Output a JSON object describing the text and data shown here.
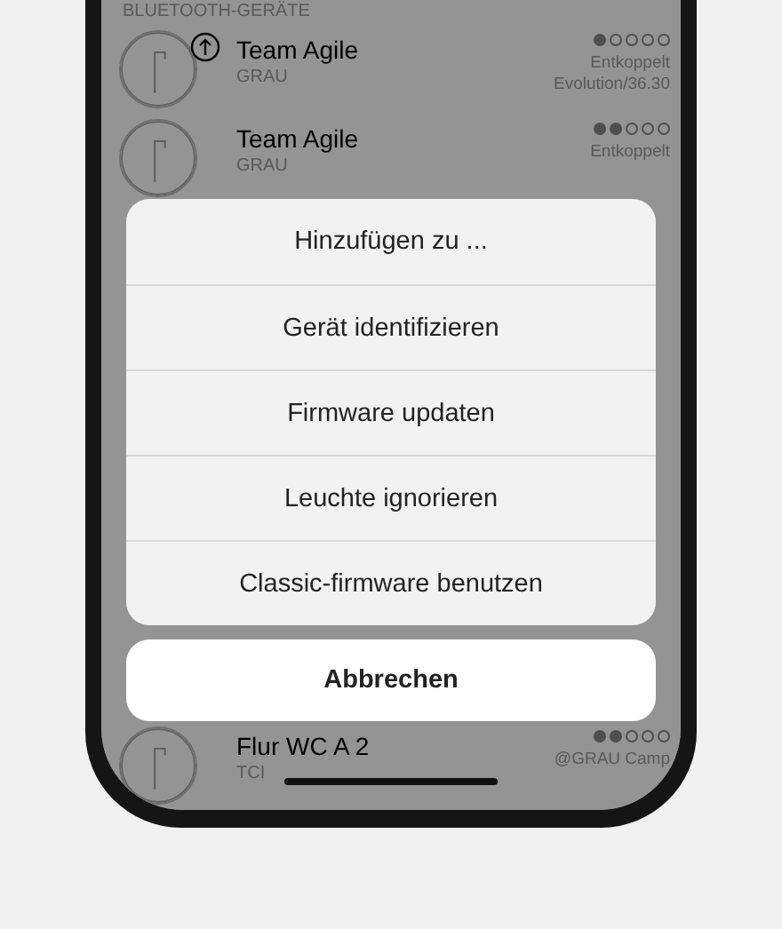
{
  "list": {
    "header": "BLUETOOTH-GERÄTE",
    "devices": [
      {
        "name": "Team Agile",
        "group": "GRAU",
        "stars": 1,
        "details": [
          "Entkoppelt",
          "Evolution/36.30"
        ],
        "update_available": true
      },
      {
        "name": "Team Agile",
        "group": "GRAU",
        "stars": 2,
        "details": [
          "Entkoppelt"
        ],
        "update_available": false
      },
      {
        "name": "Flur WC A 2",
        "group": "TCI",
        "stars": 2,
        "details": [
          "@GRAU Camp"
        ],
        "update_available": false
      }
    ]
  },
  "action_sheet": {
    "actions": [
      "Hinzufügen zu ...",
      "Gerät identifizieren",
      "Firmware updaten",
      "Leuchte ignorieren",
      "Classic-firmware benutzen"
    ],
    "cancel": "Abbrechen"
  }
}
